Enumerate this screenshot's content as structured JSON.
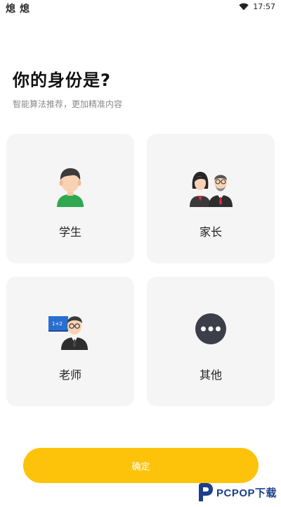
{
  "status_bar": {
    "app_icons": [
      "熄",
      "熄"
    ],
    "time": "17:57"
  },
  "header": {
    "title": "你的身份是?",
    "subtitle": "智能算法推荐，更加精准内容"
  },
  "roles": [
    {
      "id": "student",
      "label": "学生",
      "icon": "student-avatar-icon"
    },
    {
      "id": "parent",
      "label": "家长",
      "icon": "parents-avatar-icon"
    },
    {
      "id": "teacher",
      "label": "老师",
      "icon": "teacher-avatar-icon"
    },
    {
      "id": "other",
      "label": "其他",
      "icon": "more-dots-icon"
    }
  ],
  "confirm_button": {
    "label": "确定"
  },
  "watermark": {
    "text": "PCPOP下载"
  },
  "colors": {
    "accent": "#fcc30a",
    "card_bg": "#f5f5f5",
    "title": "#111111",
    "subtitle": "#8a8a8a",
    "watermark": "#1b3f8c"
  }
}
